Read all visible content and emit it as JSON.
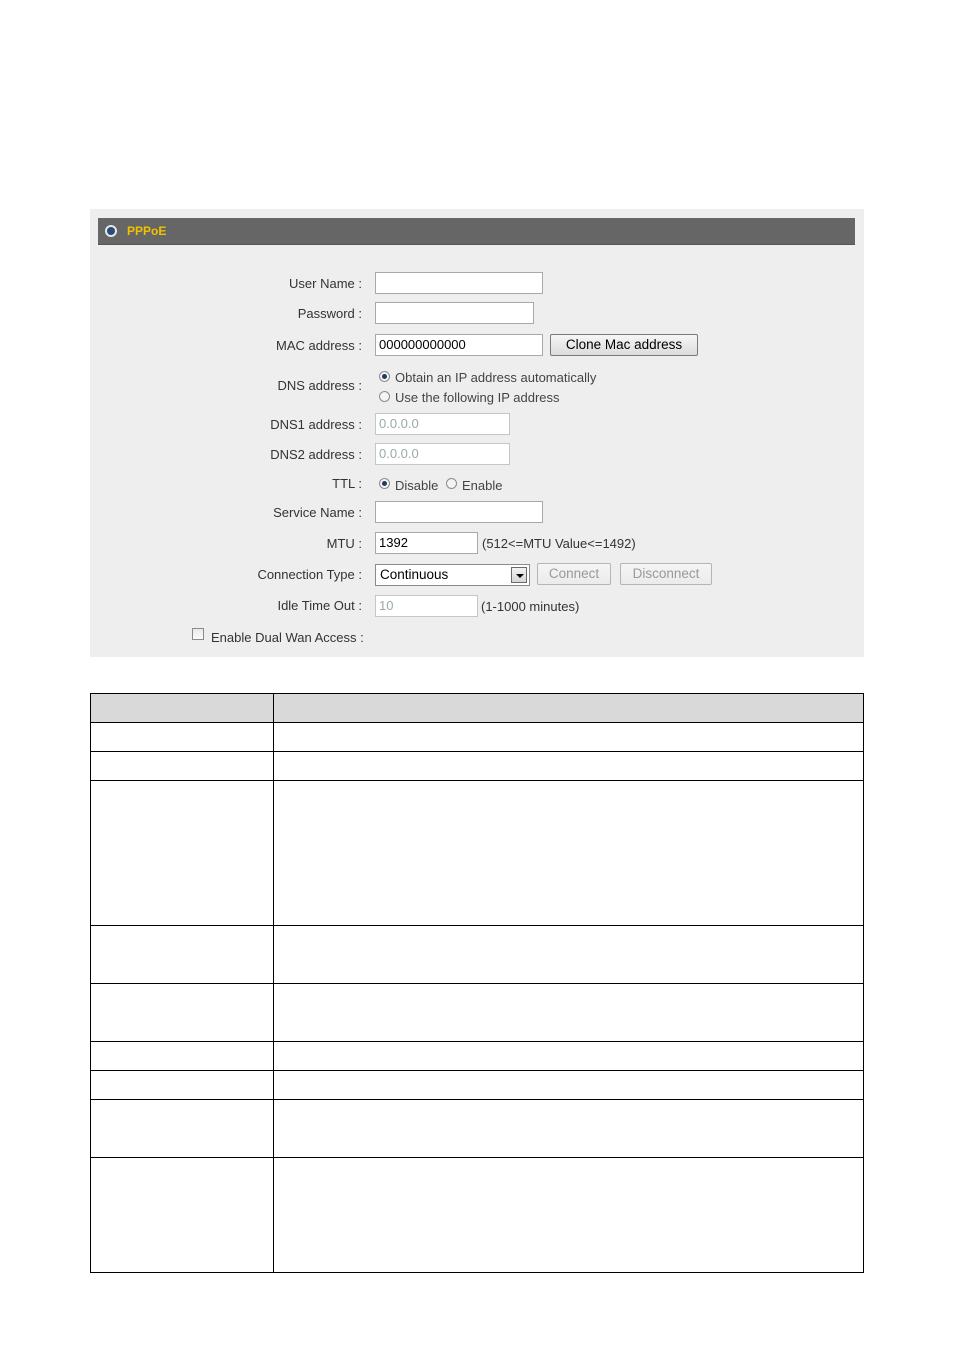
{
  "panel": {
    "title": "PPPoE",
    "labels": {
      "user_name": "User Name :",
      "password": "Password :",
      "mac_address": "MAC address :",
      "dns_address": "DNS address :",
      "dns1_address": "DNS1 address :",
      "dns2_address": "DNS2 address :",
      "ttl": "TTL :",
      "service_name": "Service Name :",
      "mtu": "MTU :",
      "connection_type": "Connection Type :",
      "idle_time_out": "Idle Time Out :"
    },
    "user_name_value": "",
    "password_value": "",
    "mac_address_value": "000000000000",
    "clone_mac_label": "Clone Mac address",
    "dns_options": {
      "auto": "Obtain an IP address automatically",
      "manual": "Use the following IP address",
      "selected": "auto"
    },
    "dns1_value": "0.0.0.0",
    "dns2_value": "0.0.0.0",
    "ttl_options": {
      "disable": "Disable",
      "enable": "Enable",
      "selected": "disable"
    },
    "service_name_value": "",
    "mtu_value": "1392",
    "mtu_hint": "(512<=MTU Value<=1492)",
    "connection_type_value": "Continuous",
    "connect_label": "Connect",
    "disconnect_label": "Disconnect",
    "idle_time_value": "10",
    "idle_time_hint": "(1-1000 minutes)",
    "dual_wan_label": "Enable Dual Wan Access :",
    "dual_wan_checked": false
  },
  "colors": {
    "header_bg": "#666666",
    "header_title": "#f2c200",
    "panel_bg": "#eeeeee",
    "table_header_bg": "#d9d9d9"
  }
}
